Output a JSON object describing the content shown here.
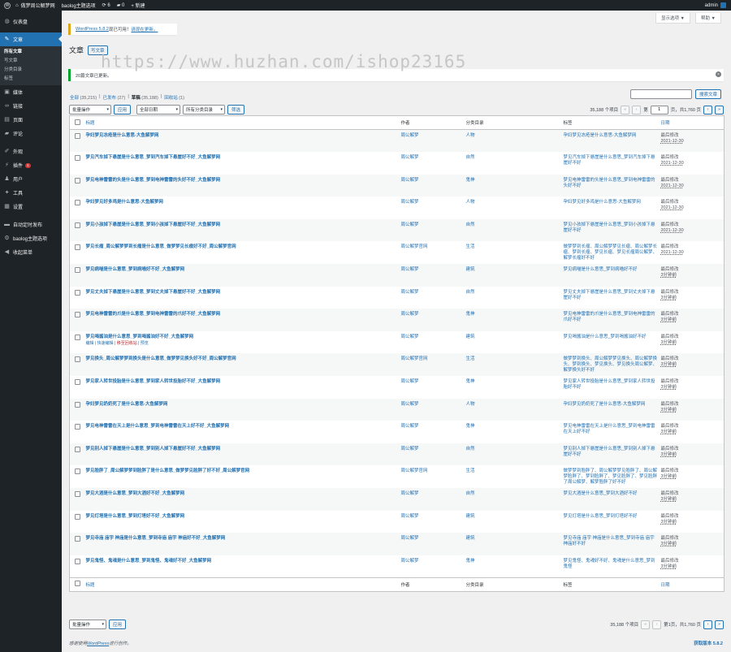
{
  "adminbar": {
    "site_name": "做梦周公解梦网",
    "theme_options": "baolog主题选项",
    "updates_count": "6",
    "comments_count": "0",
    "new_label": "+ 新建",
    "user": "admin"
  },
  "sidebar": {
    "items": [
      {
        "label": "仪表盘",
        "icon": "dashboard-icon"
      },
      {
        "label": "文章",
        "icon": "pin-icon"
      },
      {
        "label": "媒体",
        "icon": "media-icon"
      },
      {
        "label": "链接",
        "icon": "link-icon"
      },
      {
        "label": "页面",
        "icon": "page-icon"
      },
      {
        "label": "评论",
        "icon": "comment-icon"
      },
      {
        "label": "外观",
        "icon": "brush-icon"
      },
      {
        "label": "插件",
        "icon": "plugin-icon",
        "badge": "1"
      },
      {
        "label": "用户",
        "icon": "user-icon"
      },
      {
        "label": "工具",
        "icon": "tools-icon"
      },
      {
        "label": "设置",
        "icon": "settings-icon"
      },
      {
        "label": "自动定时发布",
        "icon": "clock-icon"
      },
      {
        "label": "baolog主题选项",
        "icon": "gear-icon"
      },
      {
        "label": "收起菜单",
        "icon": "collapse-icon"
      }
    ],
    "submenu": [
      "所有文章",
      "写文章",
      "分类目录",
      "标签"
    ]
  },
  "screen_options": "显示选项 ▼",
  "help": "帮助 ▼",
  "update_notice": {
    "link": "WordPress 5.8.2",
    "middle": "现已可用！",
    "action": "请现在更新。"
  },
  "page_title": "文章",
  "add_new": "写文章",
  "watermark": "https://www.huzhan.com/ishop23165",
  "success_notice": "20篇文章已更新。",
  "views": [
    {
      "label": "全部",
      "count": "(35,215)"
    },
    {
      "label": "已发布",
      "count": "(27)"
    },
    {
      "label": "草稿",
      "count": "(35,188)"
    },
    {
      "label": "回收站",
      "count": "(1)"
    }
  ],
  "search_button": "搜索文章",
  "tablenav": {
    "bulk": "批量操作",
    "apply": "应用",
    "dates": "全部日期",
    "cats": "所有分类目录",
    "filter": "筛选",
    "items_count": "35,188 个项目",
    "page_label": "第",
    "page_num": "1",
    "page_total": "页，共1,760 页",
    "bottom_page": "第1页，共1,760 页"
  },
  "columns": {
    "title": "标题",
    "author": "作者",
    "category": "分类目录",
    "tags": "标签",
    "date": "日期"
  },
  "rows": [
    {
      "title": "孕妇梦见冻疮是什么意思-大鱼解梦网",
      "author": "周公解梦",
      "cat": "人物",
      "tags": "孕妇梦见冻疮是什么意思-大鱼解梦网",
      "status": "最后修改",
      "date": "2021-12-30"
    },
    {
      "title": "梦见汽车掉下悬崖是什么意思_梦到汽车掉下悬崖好不好_大鱼解梦网",
      "author": "周公解梦",
      "cat": "自然",
      "tags": "梦见汽车掉下悬崖是什么意思_梦到汽车掉下悬崖好不好",
      "status": "最后修改",
      "date": "2021-12-30"
    },
    {
      "title": "梦见电神雷雷的头是什么意思_梦到电神雷雷的头好不好_大鱼解梦网",
      "author": "周公解梦",
      "cat": "鬼神",
      "tags": "梦见电神雷雷的头是什么意思_梦到电神雷雷的头好不好",
      "status": "最后修改",
      "date": "2021-12-30"
    },
    {
      "title": "孕妇梦见好多鸡是什么意思-大鱼解梦网",
      "author": "周公解梦",
      "cat": "人物",
      "tags": "孕妇梦见好多鸡是什么意思-大鱼解梦网",
      "status": "最后修改",
      "date": "2021-12-30"
    },
    {
      "title": "梦见小孩掉下悬崖是什么意思_梦到小孩掉下悬崖好不好_大鱼解梦网",
      "author": "周公解梦",
      "cat": "自然",
      "tags": "梦见小孩掉下悬崖是什么意思_梦到小孩掉下悬崖好不好",
      "status": "最后修改",
      "date": "2021-12-30"
    },
    {
      "title": "梦见长瘤_周公解梦梦到长瘤是什么意思_做梦梦见长瘤好不好_周公解梦官网",
      "author": "周公解梦官网",
      "cat": "生活",
      "tags": "做梦梦到长瘤、周公解梦梦见长瘤、周公解梦长瘤、梦到长瘤、梦见长瘤、梦见长瘤周公解梦、解梦长瘤好不好",
      "status": "最后修改",
      "date": "2021-12-30"
    },
    {
      "title": "梦见病喵是什么意思_梦到病喵好不好_大鱼解梦网",
      "author": "周公解梦",
      "cat": "建筑",
      "tags": "梦见病喵是什么意思_梦到病喵好不好",
      "status": "最后修改",
      "date": "3分钟前"
    },
    {
      "title": "梦见丈夫掉下悬崖是什么意思_梦到丈夫掉下悬崖好不好_大鱼解梦网",
      "author": "周公解梦",
      "cat": "自然",
      "tags": "梦见丈夫掉下悬崖是什么意思_梦到丈夫掉下悬崖好不好",
      "status": "最后修改",
      "date": "3分钟前"
    },
    {
      "title": "梦见电神雷雷的爪是什么意思_梦到电神雷雷的爪好不好_大鱼解梦网",
      "author": "周公解梦",
      "cat": "鬼神",
      "tags": "梦见电神雷雷的爪是什么意思_梦到电神雷雷的爪好不好",
      "status": "最后修改",
      "date": "3分钟前"
    },
    {
      "title": "梦见喝酱油是什么意思_梦到喝酱油好不好_大鱼解梦网",
      "author": "周公解梦",
      "cat": "建筑",
      "tags": "梦见喝酱油是什么意思_梦到喝酱油好不好",
      "status": "最后修改",
      "date": "3分钟前",
      "actions": true
    },
    {
      "title": "梦见换头_周公解梦梦到换头是什么意思_做梦梦见换头好不好_周公解梦官网",
      "author": "周公解梦官网",
      "cat": "生活",
      "tags": "做梦梦到换头、周公解梦梦见换头、周公解梦换头、梦到换头、梦见换头、梦见换头周公解梦、解梦换头好不好",
      "status": "最后修改",
      "date": "3分钟前"
    },
    {
      "title": "梦见家人转世投胎是什么意思_梦到家人转世投胎好不好_大鱼解梦网",
      "author": "周公解梦",
      "cat": "鬼神",
      "tags": "梦见家人转世投胎是什么意思_梦到家人转世投胎好不好",
      "status": "最后修改",
      "date": "3分钟前"
    },
    {
      "title": "孕妇梦见奶奶死了是什么意思-大鱼解梦网",
      "author": "周公解梦",
      "cat": "人物",
      "tags": "孕妇梦见奶奶死了是什么意思-大鱼解梦网",
      "status": "最后修改",
      "date": "3分钟前"
    },
    {
      "title": "梦见电神雷雷在天上是什么意思_梦到电神雷雷在天上好不好_大鱼解梦网",
      "author": "周公解梦",
      "cat": "鬼神",
      "tags": "梦见电神雷雷在天上是什么意思_梦到电神雷雷在天上好不好",
      "status": "最后修改",
      "date": "3分钟前"
    },
    {
      "title": "梦见别人掉下悬崖是什么意思_梦到别人掉下悬崖好不好_大鱼解梦网",
      "author": "周公解梦",
      "cat": "自然",
      "tags": "梦见别人掉下悬崖是什么意思_梦到别人掉下悬崖好不好",
      "status": "最后修改",
      "date": "3分钟前"
    },
    {
      "title": "梦见脸胖了_周公解梦梦到脸胖了是什么意思_做梦梦见脸胖了好不好_周公解梦官网",
      "author": "周公解梦官网",
      "cat": "生活",
      "tags": "做梦梦到脸胖了、周公解梦梦见脸胖了、周公解梦脸胖了、梦到脸胖了、梦见脸胖了、梦见脸胖了周公解梦、解梦脸胖了好不好",
      "status": "最后修改",
      "date": "3分钟前"
    },
    {
      "title": "梦见大酒是什么意思_梦到大酒好不好_大鱼解梦网",
      "author": "周公解梦",
      "cat": "自然",
      "tags": "梦见大酒是什么意思_梦到大酒好不好",
      "status": "最后修改",
      "date": "3分钟前"
    },
    {
      "title": "梦见灯塔是什么意思_梦到灯塔好不好_大鱼解梦网",
      "author": "周公解梦",
      "cat": "建筑",
      "tags": "梦见灯塔是什么意思_梦到灯塔好不好",
      "status": "最后修改",
      "date": "3分钟前"
    },
    {
      "title": "梦见寺庙 庙宇 神庙是什么意思_梦到寺庙 庙宇 神庙好不好_大鱼解梦网",
      "author": "周公解梦",
      "cat": "建筑",
      "tags": "梦见寺庙 庙宇 神庙是什么意思_梦到寺庙 庙宇 神庙好不好",
      "status": "最后修改",
      "date": "3分钟前"
    },
    {
      "title": "梦见鬼怪、鬼魂是什么意思_梦到鬼怪、鬼魂好不好_大鱼解梦网",
      "author": "周公解梦",
      "cat": "鬼神",
      "tags": "梦见鬼怪、鬼魂好不好、鬼魂是什么意思_梦到鬼怪",
      "status": "最后修改",
      "date": "3分钟前"
    }
  ],
  "row_actions": {
    "edit": "编辑",
    "quick": "快速编辑",
    "trash": "移至回收站",
    "preview": "预览"
  },
  "footer": {
    "left_prefix": "感谢使用",
    "left_link": "WordPress",
    "left_suffix": "进行创作。",
    "version": "获取版本 5.8.2"
  }
}
